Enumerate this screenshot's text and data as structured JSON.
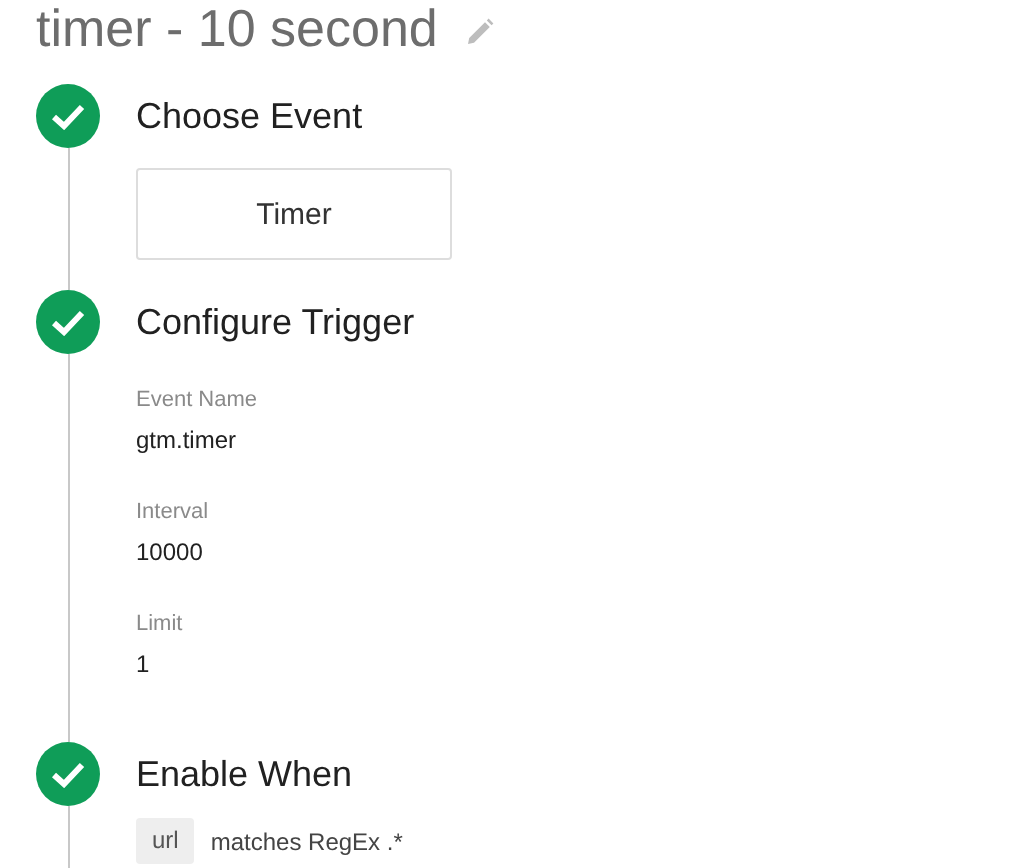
{
  "title": "timer - 10 second",
  "steps": [
    {
      "title": "Choose Event",
      "complete": true,
      "kind": "choice",
      "choice": "Timer"
    },
    {
      "title": "Configure Trigger",
      "complete": true,
      "kind": "fields",
      "fields": [
        {
          "label": "Event Name",
          "value": "gtm.timer"
        },
        {
          "label": "Interval",
          "value": "10000"
        },
        {
          "label": "Limit",
          "value": "1"
        }
      ]
    },
    {
      "title": "Enable When",
      "complete": true,
      "kind": "condition",
      "variable": "url",
      "condition": "matches RegEx .*"
    }
  ]
}
